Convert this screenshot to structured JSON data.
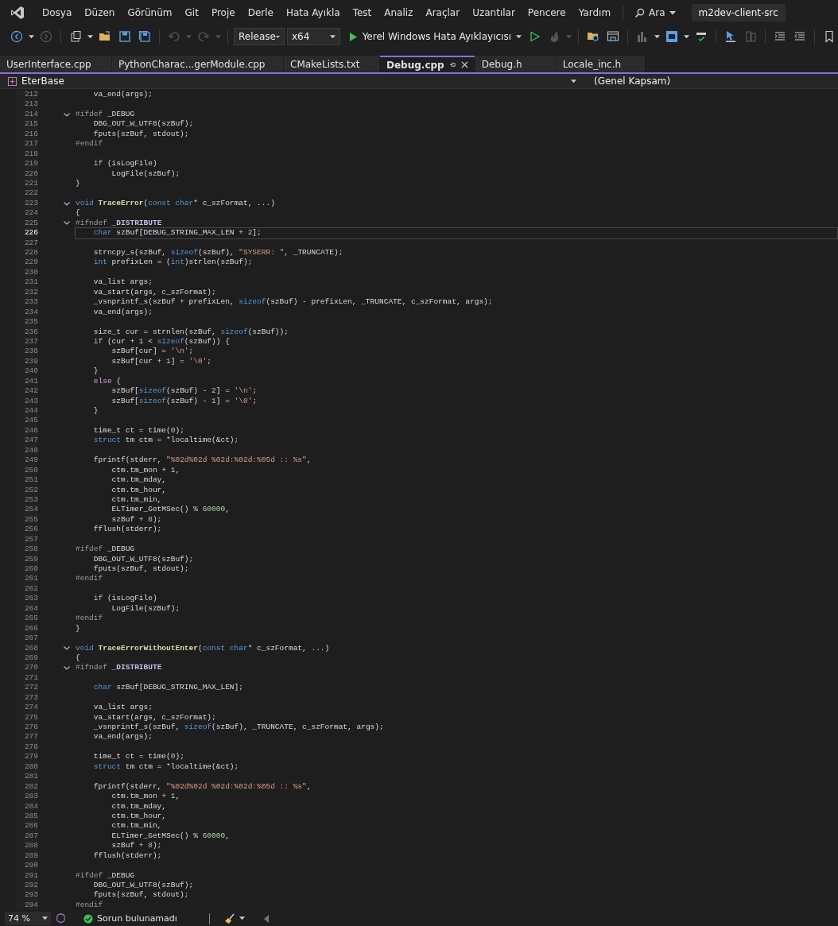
{
  "menu_bar": {
    "items": [
      "Dosya",
      "Düzen",
      "Görünüm",
      "Git",
      "Proje",
      "Derle",
      "Hata Ayıkla",
      "Test",
      "Analiz",
      "Araçlar",
      "Uzantılar",
      "Pencere",
      "Yardım"
    ],
    "search": "Ara",
    "solution": "m2dev-client-src"
  },
  "toolbar": {
    "configuration": "Release",
    "platform": "x64",
    "run": "Yerel Windows Hata Ayıklayıcısı"
  },
  "tabs": [
    {
      "label": "UserInterface.cpp",
      "selected": false
    },
    {
      "label": "PythonCharac...gerModule.cpp",
      "selected": false
    },
    {
      "label": "CMakeLists.txt",
      "selected": false
    },
    {
      "label": "Debug.cpp",
      "selected": true
    },
    {
      "label": "Debug.h",
      "selected": false
    },
    {
      "label": "Locale_inc.h",
      "selected": false
    }
  ],
  "nav_bar": {
    "project": "EterBase",
    "scope": "(Genel Kapsam)"
  },
  "editor": {
    "lines": [
      {
        "number": "212",
        "fold": false,
        "current": false,
        "code": [
          {
            "kind": "plain",
            "text": "    va_end(args);"
          }
        ]
      },
      {
        "number": "213",
        "fold": false,
        "current": false
      },
      {
        "number": "214",
        "fold": true,
        "current": false,
        "code": [
          {
            "kind": "directive",
            "text": "#ifdef"
          },
          {
            "kind": "plain",
            "text": " _DEBUG"
          }
        ]
      },
      {
        "number": "215",
        "fold": false,
        "current": false,
        "code": [
          {
            "kind": "plain",
            "text": "    DBG_OUT_W_UTF8(szBuf);"
          }
        ]
      },
      {
        "number": "216",
        "fold": false,
        "current": false,
        "code": [
          {
            "kind": "plain",
            "text": "    fputs(szBuf, stdout);"
          }
        ]
      },
      {
        "number": "217",
        "fold": false,
        "current": false,
        "code": [
          {
            "kind": "directive",
            "text": "#endif"
          }
        ]
      },
      {
        "number": "218",
        "fold": false,
        "current": false
      },
      {
        "number": "219",
        "fold": false,
        "current": false,
        "code": [
          {
            "kind": "control",
            "text": "    if"
          },
          {
            "kind": "plain",
            "text": " (isLogFile)"
          }
        ]
      },
      {
        "number": "220",
        "fold": false,
        "current": false,
        "code": [
          {
            "kind": "plain",
            "text": "        LogFile(szBuf);"
          }
        ]
      },
      {
        "number": "221",
        "fold": false,
        "current": false,
        "code": [
          {
            "kind": "plain",
            "text": "}"
          }
        ]
      },
      {
        "number": "222",
        "fold": false,
        "current": false
      },
      {
        "number": "223",
        "fold": true,
        "current": false,
        "code": [
          {
            "kind": "keyword",
            "text": "void"
          },
          {
            "kind": "function",
            "text": " TraceError"
          },
          {
            "kind": "plain",
            "text": "("
          },
          {
            "kind": "keyword",
            "text": "const char"
          },
          {
            "kind": "plain",
            "text": "* c_szFormat, ...)"
          }
        ]
      },
      {
        "number": "224",
        "fold": false,
        "current": false,
        "code": [
          {
            "kind": "plain",
            "text": "{"
          }
        ]
      },
      {
        "number": "225",
        "fold": true,
        "current": false,
        "code": [
          {
            "kind": "directive",
            "text": "#ifndef"
          },
          {
            "kind": "macro",
            "text": " _DISTRIBUTE"
          }
        ]
      },
      {
        "number": "226",
        "fold": false,
        "current": true,
        "code": [
          {
            "kind": "keyword",
            "text": "    char"
          },
          {
            "kind": "plain",
            "text": " szBuf[DEBUG_STRING_MAX_LEN + "
          },
          {
            "kind": "number",
            "text": "2"
          },
          {
            "kind": "plain",
            "text": "];"
          }
        ]
      },
      {
        "number": "227",
        "fold": false,
        "current": false
      },
      {
        "number": "228",
        "fold": false,
        "current": false,
        "code": [
          {
            "kind": "plain",
            "text": "    strncpy_s(szBuf, "
          },
          {
            "kind": "keyword",
            "text": "sizeof"
          },
          {
            "kind": "plain",
            "text": "(szBuf), "
          },
          {
            "kind": "string",
            "text": "\"SYSERR: \""
          },
          {
            "kind": "plain",
            "text": ", _TRUNCATE);"
          }
        ]
      },
      {
        "number": "229",
        "fold": false,
        "current": false,
        "code": [
          {
            "kind": "keyword",
            "text": "    int"
          },
          {
            "kind": "plain",
            "text": " prefixLen = ("
          },
          {
            "kind": "keyword",
            "text": "int"
          },
          {
            "kind": "plain",
            "text": ")strlen(szBuf);"
          }
        ]
      },
      {
        "number": "230",
        "fold": false,
        "current": false
      },
      {
        "number": "231",
        "fold": false,
        "current": false,
        "code": [
          {
            "kind": "plain",
            "text": "    va_list args;"
          }
        ]
      },
      {
        "number": "232",
        "fold": false,
        "current": false,
        "code": [
          {
            "kind": "plain",
            "text": "    va_start(args, c_szFormat);"
          }
        ]
      },
      {
        "number": "233",
        "fold": false,
        "current": false,
        "code": [
          {
            "kind": "plain",
            "text": "    _vsnprintf_s(szBuf + prefixLen, "
          },
          {
            "kind": "keyword",
            "text": "sizeof"
          },
          {
            "kind": "plain",
            "text": "(szBuf) - prefixLen, _TRUNCATE, c_szFormat, args);"
          }
        ]
      },
      {
        "number": "234",
        "fold": false,
        "current": false,
        "code": [
          {
            "kind": "plain",
            "text": "    va_end(args);"
          }
        ]
      },
      {
        "number": "235",
        "fold": false,
        "current": false
      },
      {
        "number": "236",
        "fold": false,
        "current": false,
        "code": [
          {
            "kind": "plain",
            "text": "    size_t cur = strnlen(szBuf, "
          },
          {
            "kind": "keyword",
            "text": "sizeof"
          },
          {
            "kind": "plain",
            "text": "(szBuf));"
          }
        ]
      },
      {
        "number": "237",
        "fold": false,
        "current": false,
        "code": [
          {
            "kind": "control",
            "text": "    if"
          },
          {
            "kind": "plain",
            "text": " (cur + "
          },
          {
            "kind": "number",
            "text": "1"
          },
          {
            "kind": "plain",
            "text": " < "
          },
          {
            "kind": "keyword",
            "text": "sizeof"
          },
          {
            "kind": "plain",
            "text": "(szBuf)) {"
          }
        ]
      },
      {
        "number": "238",
        "fold": false,
        "current": false,
        "code": [
          {
            "kind": "plain",
            "text": "        szBuf[cur] = "
          },
          {
            "kind": "string",
            "text": "'\\n'"
          },
          {
            "kind": "plain",
            "text": ";"
          }
        ]
      },
      {
        "number": "239",
        "fold": false,
        "current": false,
        "code": [
          {
            "kind": "plain",
            "text": "        szBuf[cur + "
          },
          {
            "kind": "number",
            "text": "1"
          },
          {
            "kind": "plain",
            "text": "] = "
          },
          {
            "kind": "string",
            "text": "'\\0'"
          },
          {
            "kind": "plain",
            "text": ";"
          }
        ]
      },
      {
        "number": "240",
        "fold": false,
        "current": false,
        "code": [
          {
            "kind": "plain",
            "text": "    }"
          }
        ]
      },
      {
        "number": "241",
        "fold": false,
        "current": false,
        "code": [
          {
            "kind": "control",
            "text": "    else"
          },
          {
            "kind": "plain",
            "text": " {"
          }
        ]
      },
      {
        "number": "242",
        "fold": false,
        "current": false,
        "code": [
          {
            "kind": "plain",
            "text": "        szBuf["
          },
          {
            "kind": "keyword",
            "text": "sizeof"
          },
          {
            "kind": "plain",
            "text": "(szBuf) - "
          },
          {
            "kind": "number",
            "text": "2"
          },
          {
            "kind": "plain",
            "text": "] = "
          },
          {
            "kind": "string",
            "text": "'\\n'"
          },
          {
            "kind": "plain",
            "text": ";"
          }
        ]
      },
      {
        "number": "243",
        "fold": false,
        "current": false,
        "code": [
          {
            "kind": "plain",
            "text": "        szBuf["
          },
          {
            "kind": "keyword",
            "text": "sizeof"
          },
          {
            "kind": "plain",
            "text": "(szBuf) - "
          },
          {
            "kind": "number",
            "text": "1"
          },
          {
            "kind": "plain",
            "text": "] = "
          },
          {
            "kind": "string",
            "text": "'\\0'"
          },
          {
            "kind": "plain",
            "text": ";"
          }
        ]
      },
      {
        "number": "244",
        "fold": false,
        "current": false,
        "code": [
          {
            "kind": "plain",
            "text": "    }"
          }
        ]
      },
      {
        "number": "245",
        "fold": false,
        "current": false
      },
      {
        "number": "246",
        "fold": false,
        "current": false,
        "code": [
          {
            "kind": "plain",
            "text": "    time_t ct = time("
          },
          {
            "kind": "number",
            "text": "0"
          },
          {
            "kind": "plain",
            "text": ");"
          }
        ]
      },
      {
        "number": "247",
        "fold": false,
        "current": false,
        "code": [
          {
            "kind": "keyword",
            "text": "    struct"
          },
          {
            "kind": "plain",
            "text": " tm ctm = *localtime(&ct);"
          }
        ]
      },
      {
        "number": "248",
        "fold": false,
        "current": false
      },
      {
        "number": "249",
        "fold": false,
        "current": false,
        "code": [
          {
            "kind": "plain",
            "text": "    fprintf(stderr, "
          },
          {
            "kind": "string",
            "text": "\"%02d%02d %02d:%02d:%05d :: %s\""
          },
          {
            "kind": "plain",
            "text": ","
          }
        ]
      },
      {
        "number": "250",
        "fold": false,
        "current": false,
        "code": [
          {
            "kind": "plain",
            "text": "        ctm.tm_mon + "
          },
          {
            "kind": "number",
            "text": "1"
          },
          {
            "kind": "plain",
            "text": ","
          }
        ]
      },
      {
        "number": "251",
        "fold": false,
        "current": false,
        "code": [
          {
            "kind": "plain",
            "text": "        ctm.tm_mday,"
          }
        ]
      },
      {
        "number": "252",
        "fold": false,
        "current": false,
        "code": [
          {
            "kind": "plain",
            "text": "        ctm.tm_hour,"
          }
        ]
      },
      {
        "number": "253",
        "fold": false,
        "current": false,
        "code": [
          {
            "kind": "plain",
            "text": "        ctm.tm_min,"
          }
        ]
      },
      {
        "number": "254",
        "fold": false,
        "current": false,
        "code": [
          {
            "kind": "plain",
            "text": "        ELTimer_GetMSec() % "
          },
          {
            "kind": "number",
            "text": "60000"
          },
          {
            "kind": "plain",
            "text": ","
          }
        ]
      },
      {
        "number": "255",
        "fold": false,
        "current": false,
        "code": [
          {
            "kind": "plain",
            "text": "        szBuf + "
          },
          {
            "kind": "number",
            "text": "8"
          },
          {
            "kind": "plain",
            "text": ");"
          }
        ]
      },
      {
        "number": "256",
        "fold": false,
        "current": false,
        "code": [
          {
            "kind": "plain",
            "text": "    fflush(stderr);"
          }
        ]
      },
      {
        "number": "257",
        "fold": false,
        "current": false
      },
      {
        "number": "258",
        "fold": false,
        "current": false,
        "code": [
          {
            "kind": "directive",
            "text": "#ifdef"
          },
          {
            "kind": "plain",
            "text": " _DEBUG"
          }
        ]
      },
      {
        "number": "259",
        "fold": false,
        "current": false,
        "code": [
          {
            "kind": "plain",
            "text": "    DBG_OUT_W_UTF8(szBuf);"
          }
        ]
      },
      {
        "number": "260",
        "fold": false,
        "current": false,
        "code": [
          {
            "kind": "plain",
            "text": "    fputs(szBuf, stdout);"
          }
        ]
      },
      {
        "number": "261",
        "fold": false,
        "current": false,
        "code": [
          {
            "kind": "directive",
            "text": "#endif"
          }
        ]
      },
      {
        "number": "262",
        "fold": false,
        "current": false
      },
      {
        "number": "263",
        "fold": false,
        "current": false,
        "code": [
          {
            "kind": "control",
            "text": "    if"
          },
          {
            "kind": "plain",
            "text": " (isLogFile)"
          }
        ]
      },
      {
        "number": "264",
        "fold": false,
        "current": false,
        "code": [
          {
            "kind": "plain",
            "text": "        LogFile(szBuf);"
          }
        ]
      },
      {
        "number": "265",
        "fold": false,
        "current": false,
        "code": [
          {
            "kind": "directive",
            "text": "#endif"
          }
        ]
      },
      {
        "number": "266",
        "fold": false,
        "current": false,
        "code": [
          {
            "kind": "plain",
            "text": "}"
          }
        ]
      },
      {
        "number": "267",
        "fold": false,
        "current": false
      },
      {
        "number": "268",
        "fold": true,
        "current": false,
        "code": [
          {
            "kind": "keyword",
            "text": "void"
          },
          {
            "kind": "function",
            "text": " TraceErrorWithoutEnter"
          },
          {
            "kind": "plain",
            "text": "("
          },
          {
            "kind": "keyword",
            "text": "const char"
          },
          {
            "kind": "plain",
            "text": "* c_szFormat, ...)"
          }
        ]
      },
      {
        "number": "269",
        "fold": false,
        "current": false,
        "code": [
          {
            "kind": "plain",
            "text": "{"
          }
        ]
      },
      {
        "number": "270",
        "fold": true,
        "current": false,
        "code": [
          {
            "kind": "directive",
            "text": "#ifndef"
          },
          {
            "kind": "macro",
            "text": " _DISTRIBUTE"
          }
        ]
      },
      {
        "number": "271",
        "fold": false,
        "current": false
      },
      {
        "number": "272",
        "fold": false,
        "current": false,
        "code": [
          {
            "kind": "keyword",
            "text": "    char"
          },
          {
            "kind": "plain",
            "text": " szBuf[DEBUG_STRING_MAX_LEN];"
          }
        ]
      },
      {
        "number": "273",
        "fold": false,
        "current": false
      },
      {
        "number": "274",
        "fold": false,
        "current": false,
        "code": [
          {
            "kind": "plain",
            "text": "    va_list args;"
          }
        ]
      },
      {
        "number": "275",
        "fold": false,
        "current": false,
        "code": [
          {
            "kind": "plain",
            "text": "    va_start(args, c_szFormat);"
          }
        ]
      },
      {
        "number": "276",
        "fold": false,
        "current": false,
        "code": [
          {
            "kind": "plain",
            "text": "    _vsnprintf_s(szBuf, "
          },
          {
            "kind": "keyword",
            "text": "sizeof"
          },
          {
            "kind": "plain",
            "text": "(szBuf), _TRUNCATE, c_szFormat, args);"
          }
        ]
      },
      {
        "number": "277",
        "fold": false,
        "current": false,
        "code": [
          {
            "kind": "plain",
            "text": "    va_end(args);"
          }
        ]
      },
      {
        "number": "278",
        "fold": false,
        "current": false
      },
      {
        "number": "279",
        "fold": false,
        "current": false,
        "code": [
          {
            "kind": "plain",
            "text": "    time_t ct = time("
          },
          {
            "kind": "number",
            "text": "0"
          },
          {
            "kind": "plain",
            "text": ");"
          }
        ]
      },
      {
        "number": "280",
        "fold": false,
        "current": false,
        "code": [
          {
            "kind": "keyword",
            "text": "    struct"
          },
          {
            "kind": "plain",
            "text": " tm ctm = *localtime(&ct);"
          }
        ]
      },
      {
        "number": "281",
        "fold": false,
        "current": false
      },
      {
        "number": "282",
        "fold": false,
        "current": false,
        "code": [
          {
            "kind": "plain",
            "text": "    fprintf(stderr, "
          },
          {
            "kind": "string",
            "text": "\"%02d%02d %02d:%02d:%05d :: %s\""
          },
          {
            "kind": "plain",
            "text": ","
          }
        ]
      },
      {
        "number": "283",
        "fold": false,
        "current": false,
        "code": [
          {
            "kind": "plain",
            "text": "        ctm.tm_mon + "
          },
          {
            "kind": "number",
            "text": "1"
          },
          {
            "kind": "plain",
            "text": ","
          }
        ]
      },
      {
        "number": "284",
        "fold": false,
        "current": false,
        "code": [
          {
            "kind": "plain",
            "text": "        ctm.tm_mday,"
          }
        ]
      },
      {
        "number": "285",
        "fold": false,
        "current": false,
        "code": [
          {
            "kind": "plain",
            "text": "        ctm.tm_hour,"
          }
        ]
      },
      {
        "number": "286",
        "fold": false,
        "current": false,
        "code": [
          {
            "kind": "plain",
            "text": "        ctm.tm_min,"
          }
        ]
      },
      {
        "number": "287",
        "fold": false,
        "current": false,
        "code": [
          {
            "kind": "plain",
            "text": "        ELTimer_GetMSec() % "
          },
          {
            "kind": "number",
            "text": "60000"
          },
          {
            "kind": "plain",
            "text": ","
          }
        ]
      },
      {
        "number": "288",
        "fold": false,
        "current": false,
        "code": [
          {
            "kind": "plain",
            "text": "        szBuf + "
          },
          {
            "kind": "number",
            "text": "8"
          },
          {
            "kind": "plain",
            "text": ");"
          }
        ]
      },
      {
        "number": "289",
        "fold": false,
        "current": false,
        "code": [
          {
            "kind": "plain",
            "text": "    fflush(stderr);"
          }
        ]
      },
      {
        "number": "290",
        "fold": false,
        "current": false
      },
      {
        "number": "291",
        "fold": false,
        "current": false,
        "code": [
          {
            "kind": "directive",
            "text": "#ifdef"
          },
          {
            "kind": "plain",
            "text": " _DEBUG"
          }
        ]
      },
      {
        "number": "292",
        "fold": false,
        "current": false,
        "code": [
          {
            "kind": "plain",
            "text": "    DBG_OUT_W_UTF8(szBuf);"
          }
        ]
      },
      {
        "number": "293",
        "fold": false,
        "current": false,
        "code": [
          {
            "kind": "plain",
            "text": "    fputs(szBuf, stdout);"
          }
        ]
      },
      {
        "number": "294",
        "fold": false,
        "current": false,
        "code": [
          {
            "kind": "directive",
            "text": "#endif"
          }
        ]
      }
    ]
  },
  "status_bar": {
    "zoom": "74 %",
    "issues": "Sorun bulunamadı"
  }
}
